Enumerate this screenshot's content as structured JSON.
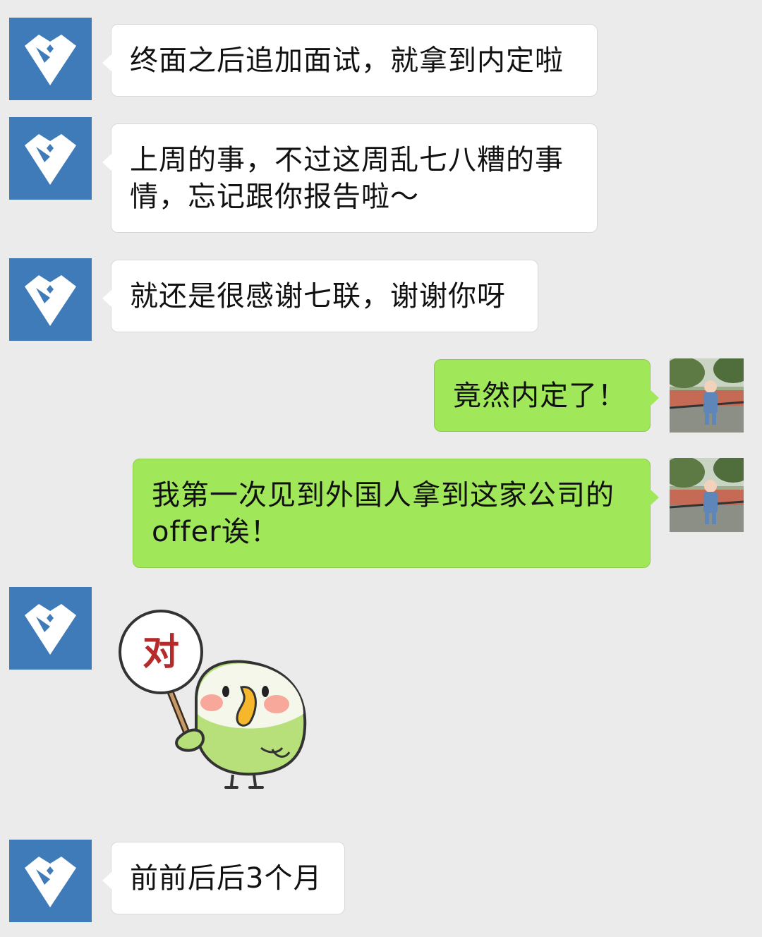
{
  "messages": [
    {
      "side": "left",
      "text": "终面之后追加面试，就拿到内定啦"
    },
    {
      "side": "left",
      "text": "上周的事，不过这周乱七八糟的事情，忘记跟你报告啦～"
    },
    {
      "side": "left",
      "text": "就还是很感谢七联，谢谢你呀"
    },
    {
      "side": "right",
      "text": "竟然内定了！"
    },
    {
      "side": "right",
      "text": "我第一次见到外国人拿到这家公司的offer诶！"
    },
    {
      "side": "left",
      "type": "sticker",
      "sticker_text": "对",
      "sticker": "parrot-holding-sign-sticker"
    },
    {
      "side": "left",
      "text": "前前后后3个月"
    }
  ],
  "colors": {
    "background": "#ebebeb",
    "bubble_incoming": "#ffffff",
    "bubble_outgoing": "#a0e75a",
    "avatar_brand": "#3f7bb9"
  },
  "icons": {
    "contact_avatar": "diamond-logo-icon",
    "user_avatar": "user-photo-avatar"
  }
}
